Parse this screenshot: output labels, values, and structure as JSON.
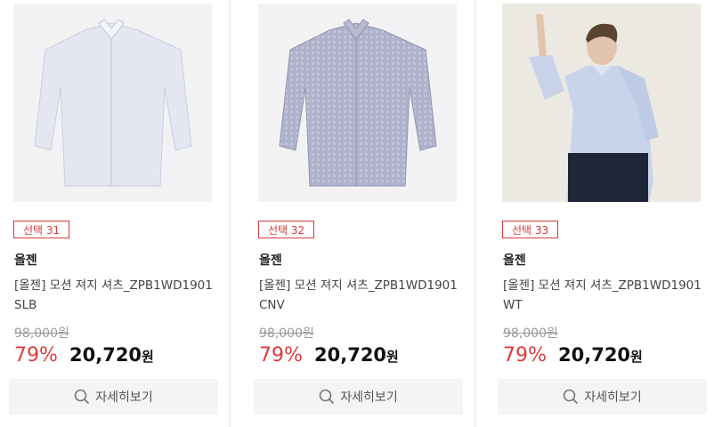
{
  "products": [
    {
      "badge": "선택 31",
      "brand": "올젠",
      "title": "[올젠] 모션 져지 셔츠_ZPB1WD1901SLB",
      "original_price": "98,000원",
      "discount": "79%",
      "price": "20,720",
      "currency": "원",
      "button_label": "자세히보기",
      "image": "white-blue dress shirt"
    },
    {
      "badge": "선택 32",
      "brand": "올젠",
      "title": "[올젠] 모션 져지 셔츠_ZPB1WD1901CNV",
      "original_price": "98,000원",
      "discount": "79%",
      "price": "20,720",
      "currency": "원",
      "button_label": "자세히보기",
      "image": "navy check dress shirt"
    },
    {
      "badge": "선택 33",
      "brand": "올젠",
      "title": "[올젠] 모션 져지 셔츠_ZPB1WD1901WT",
      "original_price": "98,000원",
      "discount": "79%",
      "price": "20,720",
      "currency": "원",
      "button_label": "자세히보기",
      "image": "model wearing light blue shirt"
    }
  ],
  "colors": {
    "accent": "#e03a3a",
    "badge_border": "#d63a3a",
    "button_bg": "#f4f4f4"
  }
}
